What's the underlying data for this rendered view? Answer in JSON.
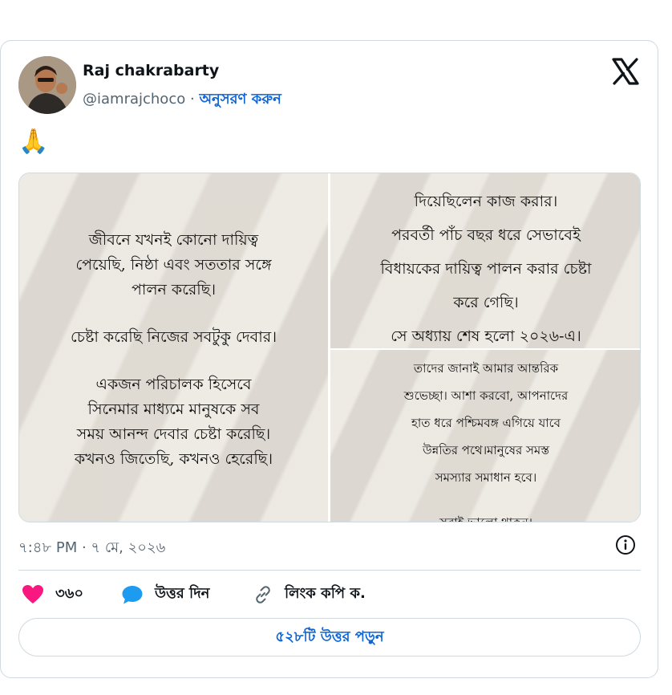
{
  "author": {
    "name": "Raj chakrabarty",
    "handle": "@iamrajchoco",
    "separator": "·",
    "follow_label": "অনুসরণ করুন"
  },
  "tweet": {
    "emoji": "🙏",
    "image_left": [
      "জীবনে যখনই কোনো দায়িত্ব",
      "পেয়েছি, নিষ্ঠা এবং সততার সঙ্গে",
      "পালন করেছি।",
      "",
      "চেষ্টা করেছি নিজের সবটুকু দেবার।",
      "",
      "একজন পরিচালক হিসেবে",
      "সিনেমার মাধ্যমে মানুষকে সব",
      "সময় আনন্দ দেবার চেষ্টা করেছি।",
      "কখনও জিতেছি, কখনও হেরেছি।"
    ],
    "image_top_right": [
      "দিয়েছিলেন কাজ করার।",
      "পরবর্তী পাঁচ বছর ধরে সেভাবেই",
      "বিধায়কের দায়িত্ব পালন করার চেষ্টা",
      "করে গেছি।",
      "সে অধ্যায় শেষ হলো ২০২৬-এ।"
    ],
    "image_bottom_right": [
      "তাদের জানাই আমার আন্তরিক",
      "শুভেচ্ছা। আশা করবো, আপনাদের",
      "হাত ধরে পশ্চিমবঙ্গ এগিয়ে যাবে",
      "উন্নতির পথে।মানুষের সমস্ত",
      "সমস্যার সমাধান হবে।",
      "",
      "সবাই ভালো থাকুন।"
    ],
    "timestamp": "৭:৪৮ PM · ৭ মে, ২০২৬"
  },
  "actions": {
    "likes": "৩৬০",
    "reply_label": "উত্তর দিন",
    "copy_link_label": "লিংক কপি ক."
  },
  "read_replies_label": "৫২৮টি উত্তর পড়ুন",
  "colors": {
    "accent": "#0f65d6",
    "heart": "#f91880",
    "reply_bubble": "#1d9bf0",
    "muted": "#536471",
    "border": "#cfd9de"
  }
}
